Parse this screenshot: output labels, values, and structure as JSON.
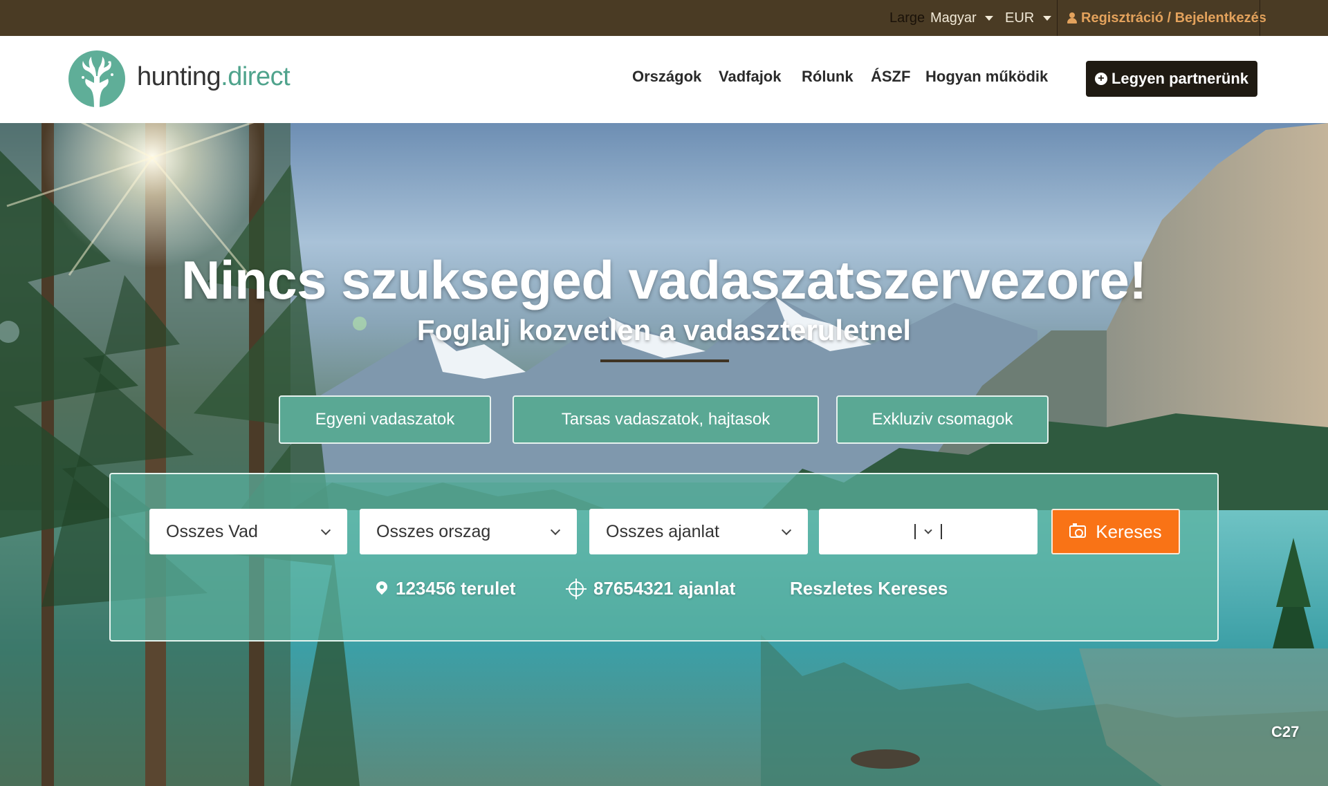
{
  "topbar": {
    "size_label": "Large",
    "language": "Magyar",
    "currency": "EUR",
    "login_label": "Regisztráció / Bejelentkezés"
  },
  "header": {
    "logo_text_main": "hunting",
    "logo_text_accent": ".direct",
    "nav": [
      {
        "label": "Országok"
      },
      {
        "label": "Vadfajok"
      },
      {
        "label": "Rólunk"
      },
      {
        "label": "ÁSZF"
      },
      {
        "label": "Hogyan működik"
      }
    ],
    "partner_button": "Legyen partnerünk"
  },
  "hero": {
    "title": "Nincs szukseged vadaszatszervezore!",
    "subtitle": "Foglalj kozvetlen a vadaszteruletnel",
    "categories": [
      {
        "label": "Egyeni vadaszatok"
      },
      {
        "label": "Tarsas vadaszatok, hajtasok"
      },
      {
        "label": "Exkluziv csomagok"
      }
    ],
    "search": {
      "game_select": "Osszes Vad",
      "country_select": "Osszes orszag",
      "offer_select": "Osszes ajanlat",
      "search_button": "Kereses"
    },
    "stats": {
      "areas": "123456 terulet",
      "offers": "87654321 ajanlat",
      "advanced": "Reszletes Kereses"
    },
    "corner_code": "C27"
  },
  "colors": {
    "topbar_bg": "#4a3b24",
    "accent_green": "#4fa38c",
    "category_button": "#5aa894",
    "search_button": "#f97316",
    "partner_button": "#1f1a12",
    "login_link": "#e3a25c"
  },
  "icons": {
    "user": "user-icon",
    "plus": "plus-circle-icon",
    "chevron": "chevron-down-icon",
    "camera": "camera-icon",
    "pin": "map-pin-icon",
    "target": "crosshair-icon",
    "logo": "deer-logo-icon"
  }
}
